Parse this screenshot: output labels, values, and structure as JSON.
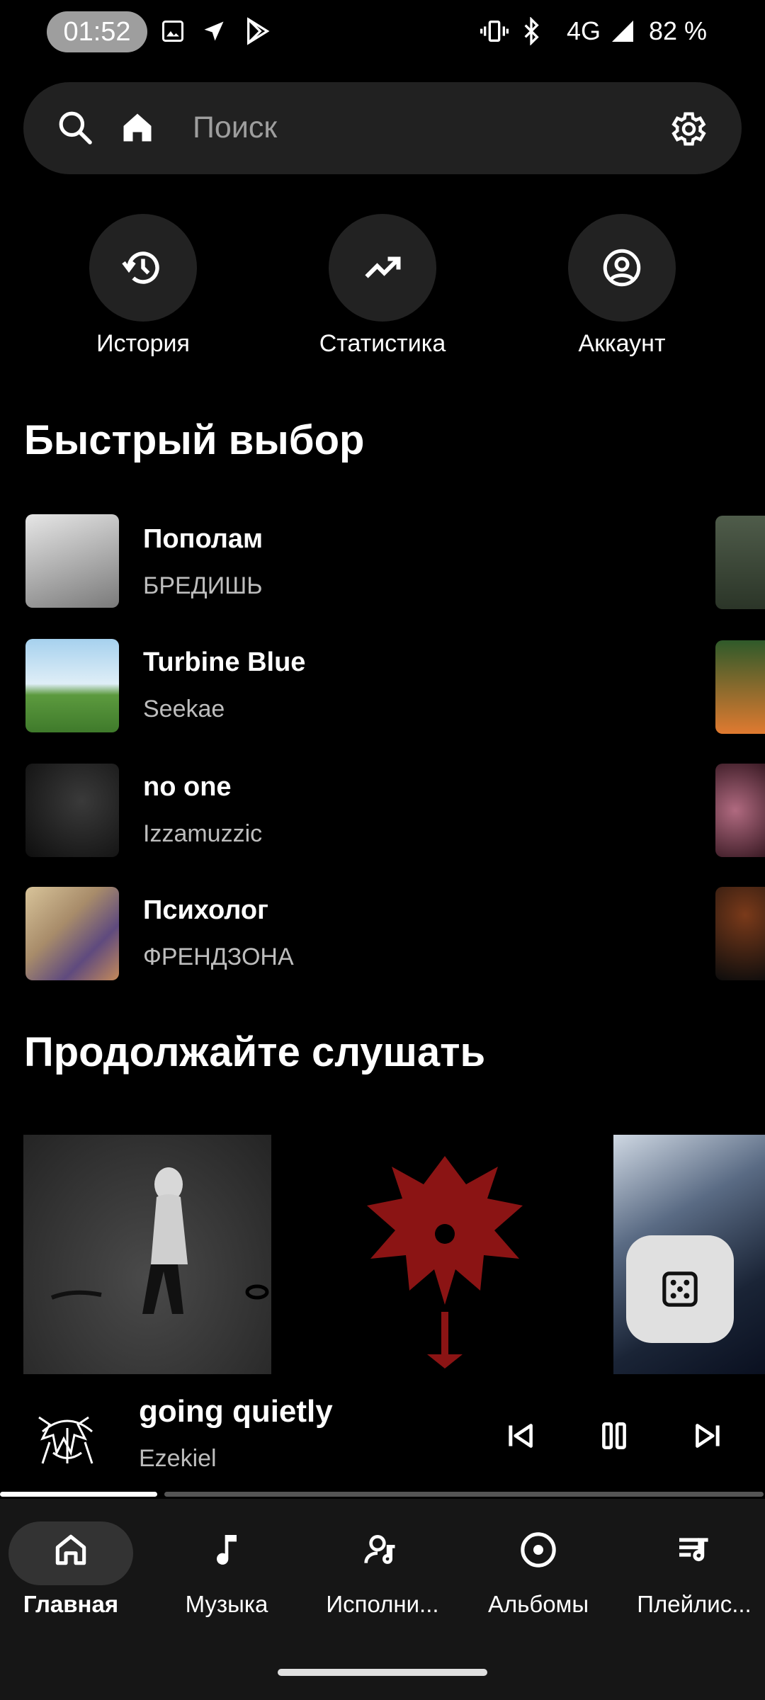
{
  "status_bar": {
    "time": "01:52",
    "network": "4G",
    "battery": "82 %",
    "icons": [
      "image-icon",
      "navigation-icon",
      "play-store-icon",
      "vibrate-icon",
      "bluetooth-icon",
      "signal-icon"
    ]
  },
  "search": {
    "placeholder": "Поиск",
    "icons": [
      "search-icon",
      "home-icon",
      "settings-icon"
    ]
  },
  "shortcuts": [
    {
      "label": "История",
      "icon": "history-icon"
    },
    {
      "label": "Статистика",
      "icon": "trending-up-icon"
    },
    {
      "label": "Аккаунт",
      "icon": "account-icon"
    }
  ],
  "quick_picks": {
    "title": "Быстрый выбор",
    "items": [
      {
        "title": "Пополам",
        "artist": "БРЕДИШЬ",
        "thumb_colors": [
          "#d9d9d9",
          "#6b6b6b"
        ]
      },
      {
        "title": "Turbine Blue",
        "artist": "Seekae",
        "thumb_colors": [
          "#9cc8e6",
          "#4f8f3a"
        ]
      },
      {
        "title": "no one",
        "artist": "Izzamuzzic",
        "thumb_colors": [
          "#2a2a2a",
          "#111111"
        ]
      },
      {
        "title": "Психолог",
        "artist": "ФРЕНДЗОНА",
        "thumb_colors": [
          "#c9b48a",
          "#6a4f7a"
        ]
      }
    ],
    "side_column_colors": [
      "#3d4a3a",
      "#2f5a2a",
      "#7a3a4a",
      "#1a1a1a"
    ]
  },
  "continue_listening": {
    "title": "Продолжайте слушать"
  },
  "now_playing": {
    "title": "going quietly",
    "artist": "Ezekiel",
    "progress": 0.2,
    "controls": [
      "skip-previous-icon",
      "pause-icon",
      "skip-next-icon"
    ]
  },
  "bottom_nav": {
    "active": "Главная",
    "items": [
      {
        "label": "Главная",
        "icon": "home-icon"
      },
      {
        "label": "Музыка",
        "icon": "music-note-icon"
      },
      {
        "label": "Исполни...",
        "icon": "artist-icon"
      },
      {
        "label": "Альбомы",
        "icon": "album-icon"
      },
      {
        "label": "Плейлис...",
        "icon": "playlist-icon"
      }
    ]
  },
  "colors": {
    "background": "#000000",
    "surface": "#212121",
    "accent_red": "#8b1414",
    "fab": "#e0e0e0"
  }
}
